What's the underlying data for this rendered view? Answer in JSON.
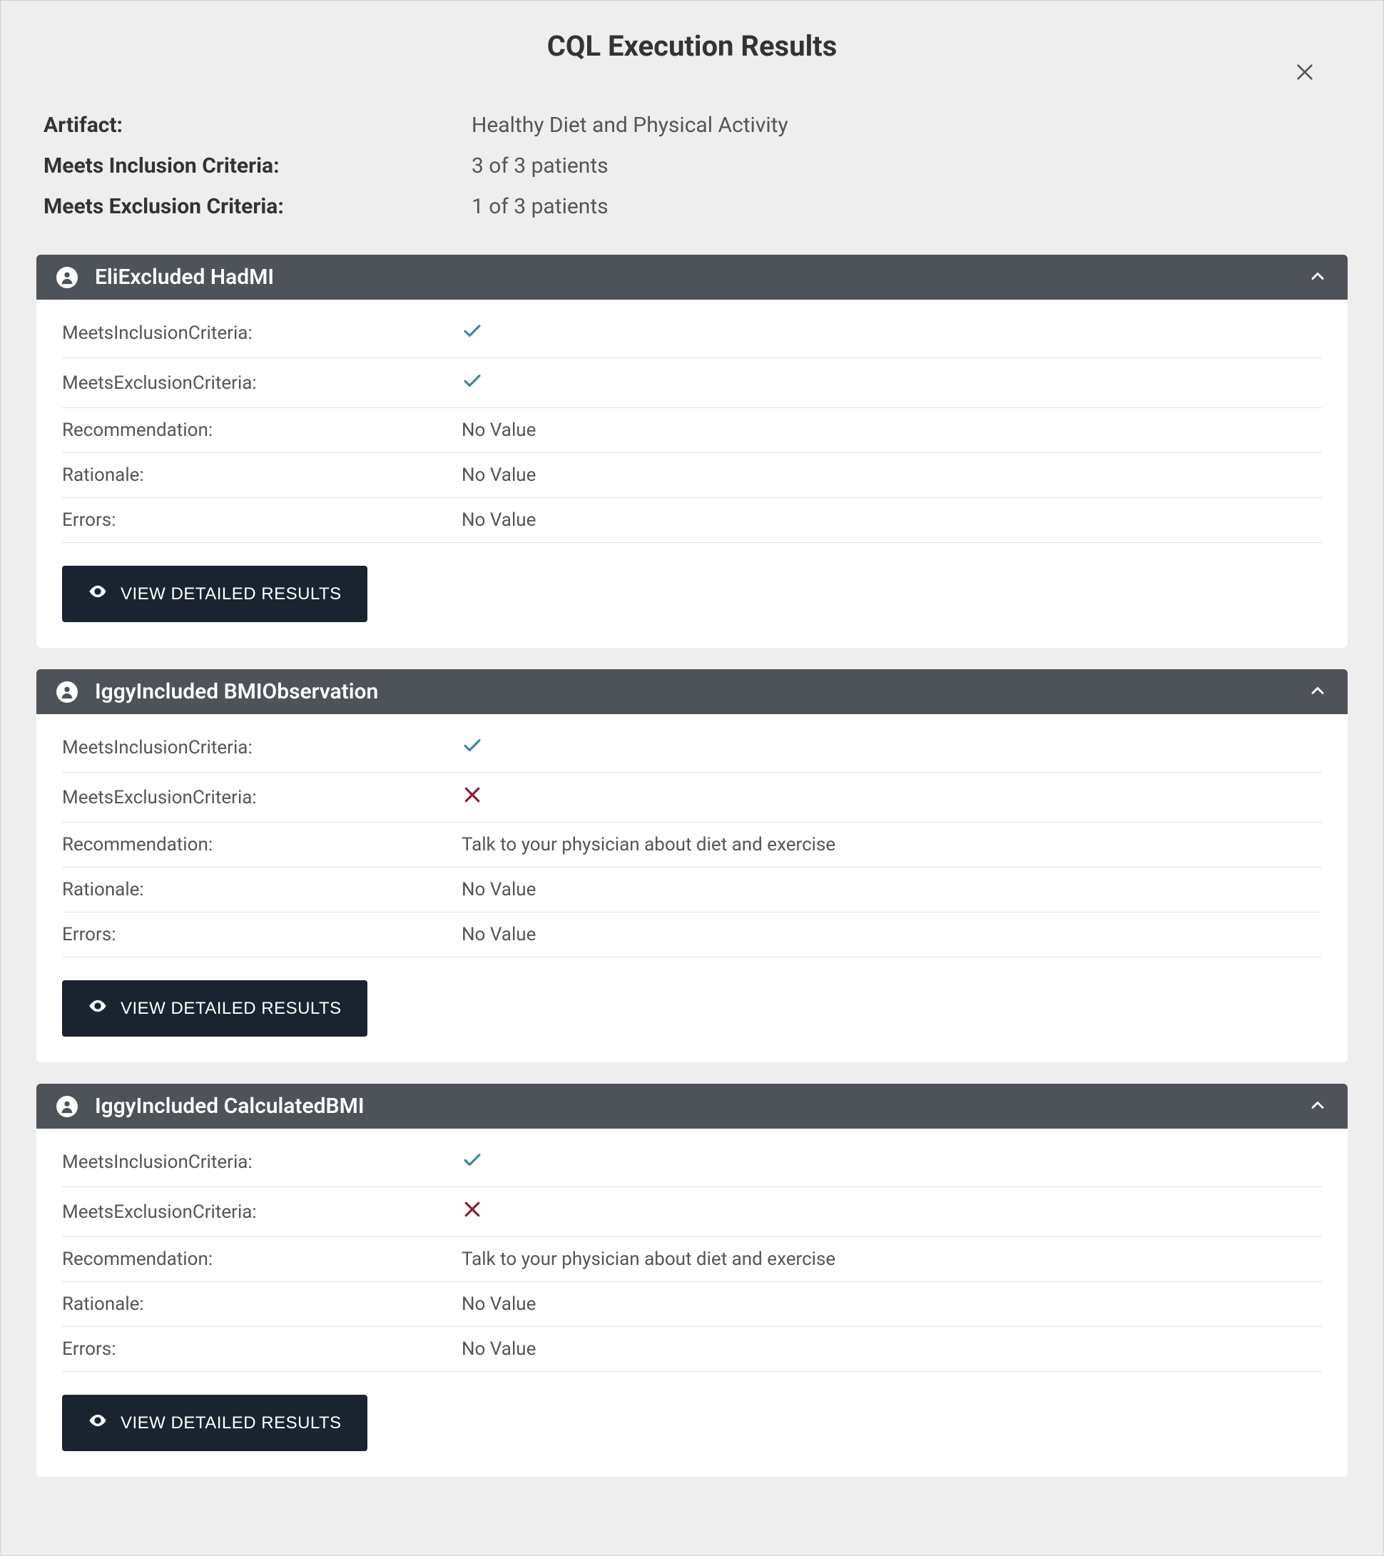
{
  "title": "CQL Execution Results",
  "summary": {
    "artifact_label": "Artifact:",
    "artifact_value": "Healthy Diet and Physical Activity",
    "inclusion_label": "Meets Inclusion Criteria:",
    "inclusion_value": "3 of 3 patients",
    "exclusion_label": "Meets Exclusion Criteria:",
    "exclusion_value": "1 of 3 patients"
  },
  "labels": {
    "meets_inclusion": "MeetsInclusionCriteria:",
    "meets_exclusion": "MeetsExclusionCriteria:",
    "recommendation": "Recommendation:",
    "rationale": "Rationale:",
    "errors": "Errors:",
    "view_detailed": "VIEW DETAILED RESULTS",
    "no_value": "No Value"
  },
  "patients": [
    {
      "name": "EliExcluded HadMI",
      "meets_inclusion": true,
      "meets_exclusion": true,
      "recommendation": "No Value",
      "rationale": "No Value",
      "errors": "No Value"
    },
    {
      "name": "IggyIncluded BMIObservation",
      "meets_inclusion": true,
      "meets_exclusion": false,
      "recommendation": "Talk to your physician about diet and exercise",
      "rationale": "No Value",
      "errors": "No Value"
    },
    {
      "name": "IggyIncluded CalculatedBMI",
      "meets_inclusion": true,
      "meets_exclusion": false,
      "recommendation": "Talk to your physician about diet and exercise",
      "rationale": "No Value",
      "errors": "No Value"
    }
  ]
}
